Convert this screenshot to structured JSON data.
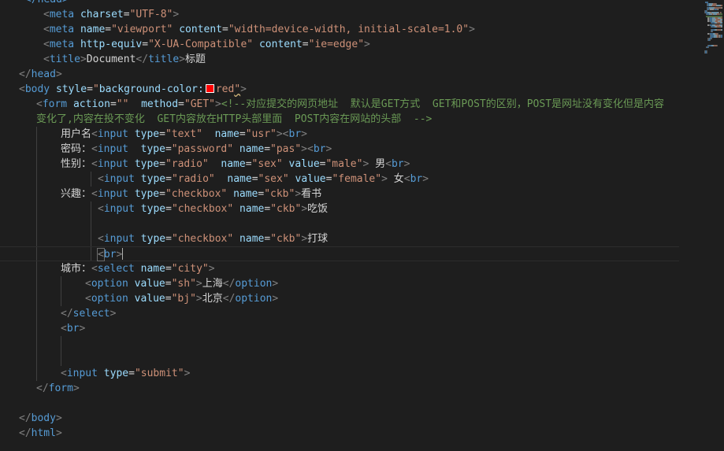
{
  "editor": {
    "language": "html",
    "colors": {
      "background": "#1e1e1e",
      "tag": "#569cd6",
      "attribute": "#9cdcfe",
      "string": "#ce9178",
      "comment": "#6a9955",
      "text": "#d4d4d4",
      "color_swatch": "red"
    },
    "lines": [
      [
        [
          "tag",
          "</head>"
        ]
      ],
      [
        [
          "punct",
          "<"
        ],
        [
          "tag",
          "meta "
        ],
        [
          "attr",
          "charset"
        ],
        [
          "eq",
          "="
        ],
        [
          "str",
          "\"UTF-8\""
        ],
        [
          "punct",
          ">"
        ]
      ],
      [
        [
          "punct",
          "<"
        ],
        [
          "tag",
          "meta "
        ],
        [
          "attr",
          "name"
        ],
        [
          "eq",
          "="
        ],
        [
          "str",
          "\"viewport\""
        ],
        [
          "text",
          " "
        ],
        [
          "attr",
          "content"
        ],
        [
          "eq",
          "="
        ],
        [
          "str",
          "\"width=device-width, initial-scale=1.0\""
        ],
        [
          "punct",
          ">"
        ]
      ],
      [
        [
          "punct",
          "<"
        ],
        [
          "tag",
          "meta "
        ],
        [
          "attr",
          "http-equiv"
        ],
        [
          "eq",
          "="
        ],
        [
          "str",
          "\"X-UA-Compatible\""
        ],
        [
          "text",
          " "
        ],
        [
          "attr",
          "content"
        ],
        [
          "eq",
          "="
        ],
        [
          "str",
          "\"ie=edge\""
        ],
        [
          "punct",
          ">"
        ]
      ],
      [
        [
          "punct",
          "<"
        ],
        [
          "tag",
          "title"
        ],
        [
          "punct",
          ">"
        ],
        [
          "text",
          "Document"
        ],
        [
          "punct",
          "</"
        ],
        [
          "tag",
          "title"
        ],
        [
          "punct",
          ">"
        ],
        [
          "text",
          "标题"
        ]
      ],
      [
        [
          "punct",
          "</"
        ],
        [
          "tag",
          "head"
        ],
        [
          "punct",
          ">"
        ]
      ],
      [
        [
          "punct",
          "<"
        ],
        [
          "tag",
          "body "
        ],
        [
          "attr",
          "style"
        ],
        [
          "eq",
          "="
        ],
        [
          "str",
          "\""
        ],
        [
          "prop",
          "background-color:"
        ],
        [
          "swatch",
          ""
        ],
        [
          "val",
          "red"
        ],
        [
          "squig",
          "\""
        ],
        [
          "punct",
          ">"
        ]
      ],
      [
        [
          "punct",
          "<"
        ],
        [
          "tag",
          "form "
        ],
        [
          "attr",
          "action"
        ],
        [
          "eq",
          "="
        ],
        [
          "str",
          "\"\""
        ],
        [
          "text",
          "  "
        ],
        [
          "attr",
          "method"
        ],
        [
          "eq",
          "="
        ],
        [
          "str",
          "\"GET\""
        ],
        [
          "punct",
          ">"
        ],
        [
          "comment",
          "<!--对应提交的网页地址  默认是GET方式  GET和POST的区别，POST是网址没有变化但是内容"
        ]
      ],
      [
        [
          "comment",
          "变化了,内容在投不变化  GET内容放在HTTP头部里面  POST内容在网站的头部  -->"
        ]
      ],
      [
        [
          "text",
          "用户名"
        ],
        [
          "punct",
          "<"
        ],
        [
          "tag",
          "input "
        ],
        [
          "attr",
          "type"
        ],
        [
          "eq",
          "="
        ],
        [
          "str",
          "\"text\""
        ],
        [
          "text",
          "  "
        ],
        [
          "attr",
          "name"
        ],
        [
          "eq",
          "="
        ],
        [
          "str",
          "\"usr\""
        ],
        [
          "punct",
          "><"
        ],
        [
          "tag",
          "br"
        ],
        [
          "punct",
          ">"
        ]
      ],
      [
        [
          "text",
          "密码："
        ],
        [
          "punct",
          "<"
        ],
        [
          "tag",
          "input "
        ],
        [
          "text",
          " "
        ],
        [
          "attr",
          "type"
        ],
        [
          "eq",
          "="
        ],
        [
          "str",
          "\"password\""
        ],
        [
          "text",
          " "
        ],
        [
          "attr",
          "name"
        ],
        [
          "eq",
          "="
        ],
        [
          "str",
          "\"pas\""
        ],
        [
          "punct",
          "><"
        ],
        [
          "tag",
          "br"
        ],
        [
          "punct",
          ">"
        ]
      ],
      [
        [
          "text",
          "性别："
        ],
        [
          "punct",
          "<"
        ],
        [
          "tag",
          "input "
        ],
        [
          "attr",
          "type"
        ],
        [
          "eq",
          "="
        ],
        [
          "str",
          "\"radio\""
        ],
        [
          "text",
          "  "
        ],
        [
          "attr",
          "name"
        ],
        [
          "eq",
          "="
        ],
        [
          "str",
          "\"sex\""
        ],
        [
          "text",
          " "
        ],
        [
          "attr",
          "value"
        ],
        [
          "eq",
          "="
        ],
        [
          "str",
          "\"male\""
        ],
        [
          "punct",
          ">"
        ],
        [
          "text",
          " 男"
        ],
        [
          "punct",
          "<"
        ],
        [
          "tag",
          "br"
        ],
        [
          "punct",
          ">"
        ]
      ],
      [
        [
          "punct",
          "<"
        ],
        [
          "tag",
          "input "
        ],
        [
          "attr",
          "type"
        ],
        [
          "eq",
          "="
        ],
        [
          "str",
          "\"radio\""
        ],
        [
          "text",
          "  "
        ],
        [
          "attr",
          "name"
        ],
        [
          "eq",
          "="
        ],
        [
          "str",
          "\"sex\""
        ],
        [
          "text",
          " "
        ],
        [
          "attr",
          "value"
        ],
        [
          "eq",
          "="
        ],
        [
          "str",
          "\"female\""
        ],
        [
          "punct",
          ">"
        ],
        [
          "text",
          " 女"
        ],
        [
          "punct",
          "<"
        ],
        [
          "tag",
          "br"
        ],
        [
          "punct",
          ">"
        ]
      ],
      [
        [
          "text",
          "兴趣："
        ],
        [
          "punct",
          "<"
        ],
        [
          "tag",
          "input "
        ],
        [
          "attr",
          "type"
        ],
        [
          "eq",
          "="
        ],
        [
          "str",
          "\"checkbox\""
        ],
        [
          "text",
          " "
        ],
        [
          "attr",
          "name"
        ],
        [
          "eq",
          "="
        ],
        [
          "str",
          "\"ckb\""
        ],
        [
          "punct",
          ">"
        ],
        [
          "text",
          "看书"
        ]
      ],
      [
        [
          "punct",
          "<"
        ],
        [
          "tag",
          "input "
        ],
        [
          "attr",
          "type"
        ],
        [
          "eq",
          "="
        ],
        [
          "str",
          "\"checkbox\""
        ],
        [
          "text",
          " "
        ],
        [
          "attr",
          "name"
        ],
        [
          "eq",
          "="
        ],
        [
          "str",
          "\"ckb\""
        ],
        [
          "punct",
          ">"
        ],
        [
          "text",
          "吃饭"
        ]
      ],
      [],
      [
        [
          "punct",
          "<"
        ],
        [
          "tag",
          "input "
        ],
        [
          "attr",
          "type"
        ],
        [
          "eq",
          "="
        ],
        [
          "str",
          "\"checkbox\""
        ],
        [
          "text",
          " "
        ],
        [
          "attr",
          "name"
        ],
        [
          "eq",
          "="
        ],
        [
          "str",
          "\"ckb\""
        ],
        [
          "punct",
          ">"
        ],
        [
          "text",
          "打球"
        ]
      ],
      [
        [
          "bracket",
          "<"
        ],
        [
          "tag",
          "br"
        ],
        [
          "punct",
          ">"
        ],
        [
          "caret",
          ""
        ]
      ],
      [
        [
          "text",
          "城市："
        ],
        [
          "punct",
          "<"
        ],
        [
          "tag",
          "select "
        ],
        [
          "attr",
          "name"
        ],
        [
          "eq",
          "="
        ],
        [
          "str",
          "\"city\""
        ],
        [
          "punct",
          ">"
        ]
      ],
      [
        [
          "punct",
          "<"
        ],
        [
          "tag",
          "option "
        ],
        [
          "attr",
          "value"
        ],
        [
          "eq",
          "="
        ],
        [
          "str",
          "\"sh\""
        ],
        [
          "punct",
          ">"
        ],
        [
          "text",
          "上海"
        ],
        [
          "punct",
          "</"
        ],
        [
          "tag",
          "option"
        ],
        [
          "punct",
          ">"
        ]
      ],
      [
        [
          "punct",
          "<"
        ],
        [
          "tag",
          "option "
        ],
        [
          "attr",
          "value"
        ],
        [
          "eq",
          "="
        ],
        [
          "str",
          "\"bj\""
        ],
        [
          "punct",
          ">"
        ],
        [
          "text",
          "北京"
        ],
        [
          "punct",
          "</"
        ],
        [
          "tag",
          "option"
        ],
        [
          "punct",
          ">"
        ]
      ],
      [
        [
          "punct",
          "</"
        ],
        [
          "tag",
          "select"
        ],
        [
          "punct",
          ">"
        ]
      ],
      [
        [
          "punct",
          "<"
        ],
        [
          "tag",
          "br"
        ],
        [
          "punct",
          ">"
        ]
      ],
      [],
      [],
      [
        [
          "punct",
          "<"
        ],
        [
          "tag",
          "input "
        ],
        [
          "attr",
          "type"
        ],
        [
          "eq",
          "="
        ],
        [
          "str",
          "\"submit\""
        ],
        [
          "punct",
          ">"
        ]
      ],
      [
        [
          "punct",
          "</"
        ],
        [
          "tag",
          "form"
        ],
        [
          "punct",
          ">"
        ]
      ],
      [],
      [
        [
          "punct",
          "</"
        ],
        [
          "tag",
          "body"
        ],
        [
          "punct",
          ">"
        ]
      ],
      [
        [
          "punct",
          "</"
        ],
        [
          "tag",
          "html"
        ],
        [
          "punct",
          ">"
        ]
      ]
    ]
  }
}
